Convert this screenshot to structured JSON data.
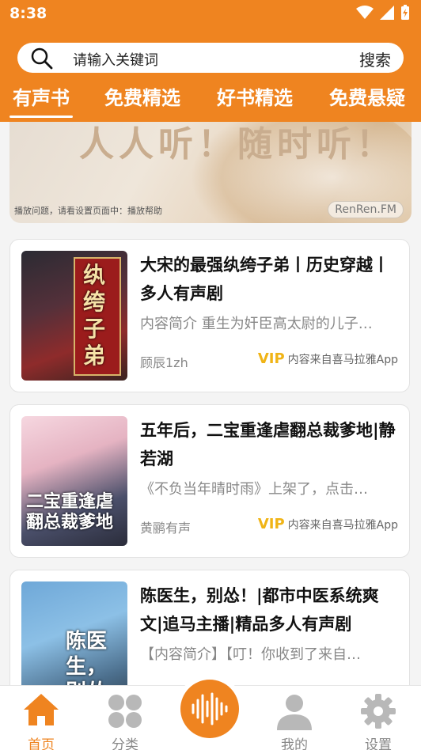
{
  "status": {
    "time": "8:38"
  },
  "search": {
    "placeholder": "请输入关键词",
    "button": "搜索"
  },
  "tabs": [
    {
      "label": "有声书",
      "active": true
    },
    {
      "label": "免费精选"
    },
    {
      "label": "好书精选"
    },
    {
      "label": "免费悬疑"
    }
  ],
  "banner": {
    "slogan": "人人听！随时听！",
    "tip": "播放问题，请看设置页面中：播放帮助",
    "brand": "RenRen.FM"
  },
  "books": [
    {
      "title": "大宋的最强纨绔子弟丨历史穿越丨多人有声剧",
      "desc": "内容简介 重生为奸臣高太尉的儿子…",
      "author": "顾辰1zh",
      "vip": "VIP",
      "source": "内容来自喜马拉雅App",
      "cover_text": "纨绔子弟"
    },
    {
      "title": "五年后，二宝重逢虐翻总裁爹地|静若湖",
      "desc": "《不负当年晴时雨》上架了，点击…",
      "author": "黄鹂有声",
      "vip": "VIP",
      "source": "内容来自喜马拉雅App",
      "cover_text": "二宝重逢虐翻总裁爹地"
    },
    {
      "title": "陈医生，别怂！|都市中医系统爽文|追马主播|精品多人有声剧",
      "desc": "【内容简介】【叮！你收到了来自…",
      "author": "",
      "vip": "",
      "source": "",
      "cover_text": "陈医生，别怂"
    }
  ],
  "tabbar": [
    {
      "label": "首页",
      "icon": "home-icon",
      "active": true
    },
    {
      "label": "分类",
      "icon": "grid-icon"
    },
    {
      "label": "",
      "icon": "audio-wave-icon"
    },
    {
      "label": "我的",
      "icon": "user-icon"
    },
    {
      "label": "设置",
      "icon": "gear-icon"
    }
  ],
  "colors": {
    "accent": "#ef8420",
    "vip": "#f0b416"
  }
}
